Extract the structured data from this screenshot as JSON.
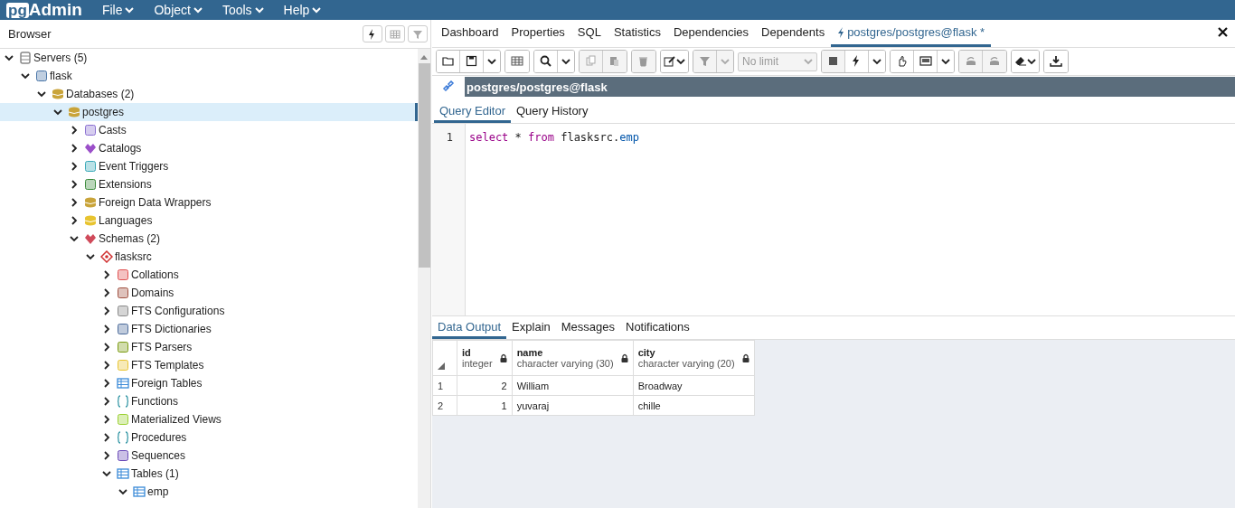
{
  "app": {
    "logo_mark": "pg",
    "logo_text": "Admin",
    "menus": [
      "File",
      "Object",
      "Tools",
      "Help"
    ]
  },
  "browser": {
    "title": "Browser",
    "tree": [
      {
        "label": "Servers (5)",
        "kind": "servers",
        "expanded": true,
        "selected": false,
        "children": [
          {
            "label": "flask",
            "kind": "server",
            "expanded": true,
            "selected": false,
            "children": [
              {
                "label": "Databases (2)",
                "kind": "databases",
                "expanded": true,
                "selected": false,
                "children": [
                  {
                    "label": "postgres",
                    "kind": "database",
                    "expanded": true,
                    "selected": true,
                    "children": [
                      {
                        "label": "Casts",
                        "kind": "casts",
                        "expanded": false,
                        "selected": false
                      },
                      {
                        "label": "Catalogs",
                        "kind": "catalogs",
                        "expanded": false,
                        "selected": false
                      },
                      {
                        "label": "Event Triggers",
                        "kind": "triggers",
                        "expanded": false,
                        "selected": false
                      },
                      {
                        "label": "Extensions",
                        "kind": "extensions",
                        "expanded": false,
                        "selected": false
                      },
                      {
                        "label": "Foreign Data Wrappers",
                        "kind": "fdw",
                        "expanded": false,
                        "selected": false
                      },
                      {
                        "label": "Languages",
                        "kind": "languages",
                        "expanded": false,
                        "selected": false
                      },
                      {
                        "label": "Schemas (2)",
                        "kind": "catalogs2",
                        "expanded": true,
                        "selected": false,
                        "children": [
                          {
                            "label": "flasksrc",
                            "kind": "schema",
                            "expanded": true,
                            "selected": false,
                            "children": [
                              {
                                "label": "Collations",
                                "kind": "collations",
                                "expanded": false,
                                "selected": false
                              },
                              {
                                "label": "Domains",
                                "kind": "domains",
                                "expanded": false,
                                "selected": false
                              },
                              {
                                "label": "FTS Configurations",
                                "kind": "ftsconf",
                                "expanded": false,
                                "selected": false
                              },
                              {
                                "label": "FTS Dictionaries",
                                "kind": "ftsdict",
                                "expanded": false,
                                "selected": false
                              },
                              {
                                "label": "FTS Parsers",
                                "kind": "ftsparser",
                                "expanded": false,
                                "selected": false
                              },
                              {
                                "label": "FTS Templates",
                                "kind": "ftstempl",
                                "expanded": false,
                                "selected": false
                              },
                              {
                                "label": "Foreign Tables",
                                "kind": "ftable",
                                "expanded": false,
                                "selected": false
                              },
                              {
                                "label": "Functions",
                                "kind": "functions",
                                "expanded": false,
                                "selected": false
                              },
                              {
                                "label": "Materialized Views",
                                "kind": "mview",
                                "expanded": false,
                                "selected": false
                              },
                              {
                                "label": "Procedures",
                                "kind": "procedures",
                                "expanded": false,
                                "selected": false
                              },
                              {
                                "label": "Sequences",
                                "kind": "sequences",
                                "expanded": false,
                                "selected": false
                              },
                              {
                                "label": "Tables (1)",
                                "kind": "tables",
                                "expanded": true,
                                "selected": false,
                                "children": [
                                  {
                                    "label": "emp",
                                    "kind": "table",
                                    "expanded": true,
                                    "selected": false
                                  }
                                ]
                              }
                            ]
                          }
                        ]
                      }
                    ]
                  }
                ]
              }
            ]
          }
        ]
      }
    ]
  },
  "tabs": [
    {
      "label": "Dashboard",
      "selected": false,
      "bolt": false
    },
    {
      "label": "Properties",
      "selected": false,
      "bolt": false
    },
    {
      "label": "SQL",
      "selected": false,
      "bolt": false
    },
    {
      "label": "Statistics",
      "selected": false,
      "bolt": false
    },
    {
      "label": "Dependencies",
      "selected": false,
      "bolt": false
    },
    {
      "label": "Dependents",
      "selected": false,
      "bolt": false
    },
    {
      "label": "postgres/postgres@flask *",
      "selected": true,
      "bolt": true
    }
  ],
  "toolbar": {
    "limit": {
      "value": "No limit",
      "disabled": true
    }
  },
  "connection": "postgres/postgres@flask",
  "editor_tabs": [
    {
      "label": "Query Editor",
      "selected": true
    },
    {
      "label": "Query History",
      "selected": false
    }
  ],
  "editor": {
    "lines": [
      {
        "number": "1",
        "tokens": [
          {
            "kind": "keyword",
            "text": "select"
          },
          {
            "kind": "plain",
            "text": " * "
          },
          {
            "kind": "keyword",
            "text": "from"
          },
          {
            "kind": "plain",
            "text": " flasksrc."
          },
          {
            "kind": "ident",
            "text": "emp"
          }
        ]
      }
    ]
  },
  "output_tabs": [
    {
      "label": "Data Output",
      "selected": true
    },
    {
      "label": "Explain",
      "selected": false
    },
    {
      "label": "Messages",
      "selected": false
    },
    {
      "label": "Notifications",
      "selected": false
    }
  ],
  "grid": {
    "columns": [
      {
        "name": "id",
        "type": "integer",
        "kind": "numeric"
      },
      {
        "name": "name",
        "type": "character varying (30)",
        "kind": "text"
      },
      {
        "name": "city",
        "type": "character varying (20)",
        "kind": "text"
      }
    ],
    "rows": [
      {
        "number": "1",
        "cells": [
          "2",
          "William",
          "Broadway"
        ]
      },
      {
        "number": "2",
        "cells": [
          "1",
          "yuvaraj",
          "chille"
        ]
      }
    ]
  }
}
